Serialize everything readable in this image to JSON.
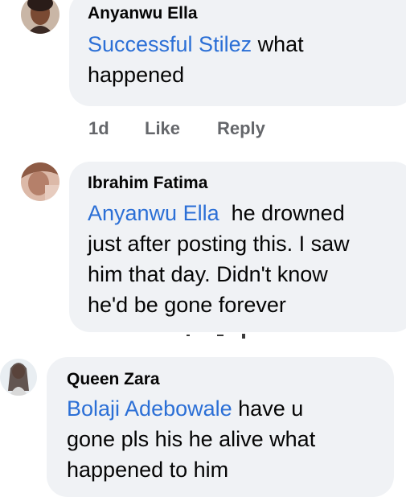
{
  "comments": [
    {
      "author": "Anyanwu Ella",
      "mention": "Successful Stilez",
      "line1_rest": " what",
      "line2": "happened",
      "time": "1d",
      "like": "Like",
      "reply": "Reply"
    },
    {
      "author": "Ibrahim Fatima",
      "mention": "Anyanwu Ella",
      "line1_rest": "  he drowned",
      "line2": "just after posting this. I saw",
      "line3": "him that day. Didn't know",
      "line4": "he'd be gone forever"
    },
    {
      "author": "Queen Zara",
      "mention": "Bolaji Adebowale",
      "line1_rest": " have u",
      "line2": "gone pls his he alive what",
      "line3": "happened to him"
    }
  ],
  "colors": {
    "bubble": "#f0f2f5",
    "mention": "#2b6fd6",
    "action": "#65676b"
  }
}
